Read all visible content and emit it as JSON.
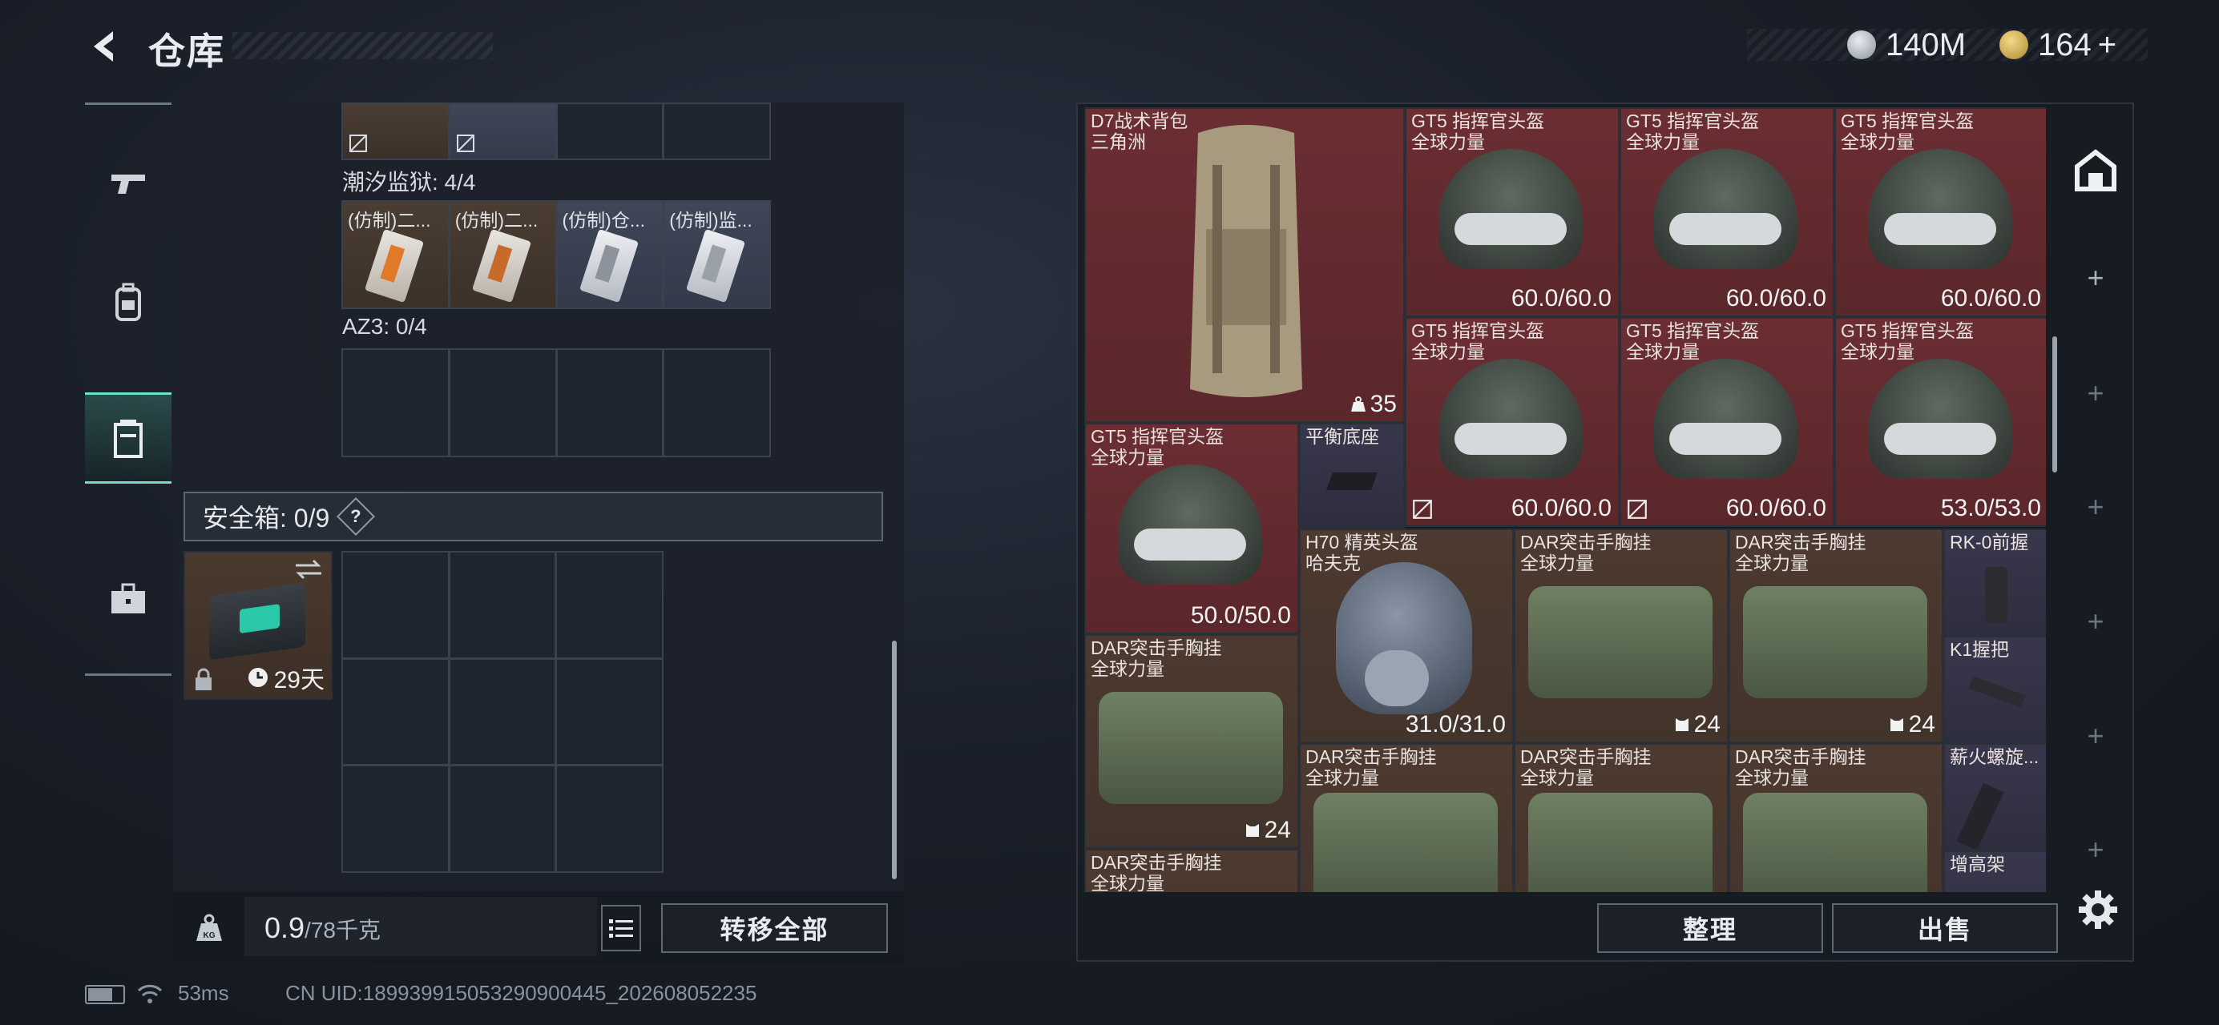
{
  "header": {
    "title": "仓库"
  },
  "currency": {
    "silver": "140M",
    "gold": "164",
    "gold_plus": "+"
  },
  "nav": {
    "items": [
      {
        "name": "weapons",
        "icon": "gun-icon"
      },
      {
        "name": "gear",
        "icon": "backpack-icon"
      },
      {
        "name": "storage",
        "icon": "container-icon",
        "active": true
      },
      {
        "name": "briefcase",
        "icon": "briefcase-icon"
      }
    ]
  },
  "left": {
    "top_slots": [
      {
        "kind": "item"
      },
      {
        "kind": "item"
      },
      {
        "kind": "empty"
      },
      {
        "kind": "empty"
      }
    ],
    "tide_label": "潮汐监狱: 4/4",
    "tide_slots": [
      {
        "label": "(仿制)二..."
      },
      {
        "label": "(仿制)二..."
      },
      {
        "label": "(仿制)仓..."
      },
      {
        "label": "(仿制)监..."
      }
    ],
    "az3_label": "AZ3: 0/4",
    "safebox_label": "安全箱: 0/9",
    "safebox_help": "?",
    "safebox_days": "29天"
  },
  "footer": {
    "weight_current": "0.9",
    "weight_total": "/78千克",
    "transfer_all": "转移全部",
    "sort": "整理",
    "sell": "出售"
  },
  "status": {
    "ping": "53ms",
    "uid": "CN UID:18993991505329090044​5_202608052235"
  },
  "stash": {
    "backpack": {
      "name": "D7战术背包",
      "sub": "三角洲",
      "count": "35"
    },
    "helmets_row1": [
      {
        "name": "GT5 指挥官头盔",
        "sub": "全球力量",
        "val": "60.0/60.0"
      },
      {
        "name": "GT5 指挥官头盔",
        "sub": "全球力量",
        "val": "60.0/60.0"
      },
      {
        "name": "GT5 指挥官头盔",
        "sub": "全球力量",
        "val": "60.0/60.0"
      }
    ],
    "helmets_row2": [
      {
        "name": "GT5 指挥官头盔",
        "sub": "全球力量",
        "val": "60.0/60.0"
      },
      {
        "name": "GT5 指挥官头盔",
        "sub": "全球力量",
        "val": "60.0/60.0"
      },
      {
        "name": "GT5 指挥官头盔",
        "sub": "全球力量",
        "val": "53.0/53.0"
      }
    ],
    "helmet_left": {
      "name": "GT5 指挥官头盔",
      "sub": "全球力量",
      "val": "50.0/50.0"
    },
    "base": {
      "name": "平衡底座"
    },
    "h70": {
      "name": "H70 精英头盔",
      "sub": "哈夫克",
      "val": "31.0/31.0"
    },
    "rigs": [
      {
        "name": "DAR突击手胸挂",
        "sub": "全球力量",
        "count": "24"
      },
      {
        "name": "DAR突击手胸挂",
        "sub": "全球力量",
        "count": "24"
      },
      {
        "name": "DAR突击手胸挂",
        "sub": "全球力量",
        "count": "24"
      },
      {
        "name": "DAR突击手胸挂",
        "sub": "全球力量"
      },
      {
        "name": "DAR突击手胸挂",
        "sub": "全球力量"
      },
      {
        "name": "DAR突击手胸挂",
        "sub": "全球力量"
      },
      {
        "name": "DAR突击手胸挂",
        "sub": "全球力量"
      }
    ],
    "attachments": [
      {
        "name": "RK-0前握"
      },
      {
        "name": "K1握把"
      },
      {
        "name": "薪火螺旋..."
      },
      {
        "name": "增高架"
      }
    ]
  },
  "colors": {
    "accent": "#6fe0c4",
    "tile_red": "#6b2e33",
    "tile_brown": "#4d3a30",
    "tile_purple": "#39374c"
  }
}
